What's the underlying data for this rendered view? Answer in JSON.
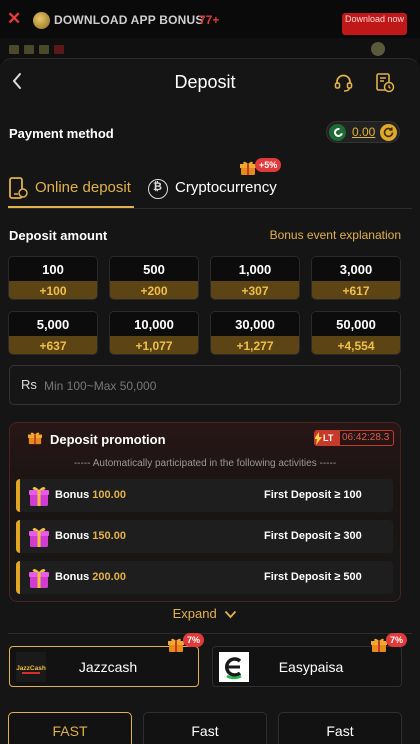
{
  "promo_bar": {
    "close_icon": "close-icon",
    "text": "DOWNLOAD APP  BONUS",
    "value": "77+",
    "download_label": "Download now"
  },
  "header": {
    "title": "Deposit",
    "back_icon": "chevron-left-icon",
    "support_icon": "headset-icon",
    "history_icon": "history-icon"
  },
  "payment_method": {
    "label": "Payment method",
    "balance": "0.00",
    "flag_icon": "pakistan-flag-icon",
    "refresh_icon": "refresh-icon"
  },
  "tabs": [
    {
      "label": "Online deposit",
      "icon": "phone-icon",
      "active": true
    },
    {
      "label": "Cryptocurrency",
      "icon": "crypto-coin-icon",
      "badge": "+5%",
      "active": false
    }
  ],
  "deposit_amount": {
    "label": "Deposit amount",
    "bonus_link": "Bonus event explanation",
    "options": [
      {
        "amount": "100",
        "bonus": "+100"
      },
      {
        "amount": "500",
        "bonus": "+200"
      },
      {
        "amount": "1,000",
        "bonus": "+307"
      },
      {
        "amount": "3,000",
        "bonus": "+617"
      },
      {
        "amount": "5,000",
        "bonus": "+637"
      },
      {
        "amount": "10,000",
        "bonus": "+1,077"
      },
      {
        "amount": "30,000",
        "bonus": "+1,277"
      },
      {
        "amount": "50,000",
        "bonus": "+4,554"
      }
    ],
    "currency": "Rs",
    "placeholder": "Min 100~Max 50,000"
  },
  "promotion": {
    "title": "Deposit promotion",
    "lt_tag": "LT",
    "countdown": "06:42:28.3",
    "subtitle": "----- Automatically participated in the following activities -----",
    "rows": [
      {
        "bonus_prefix": "Bonus",
        "bonus_value": "100.00",
        "condition": "First Deposit ≥ 100"
      },
      {
        "bonus_prefix": "Bonus",
        "bonus_value": "150.00",
        "condition": "First Deposit ≥ 300"
      },
      {
        "bonus_prefix": "Bonus",
        "bonus_value": "200.00",
        "condition": "First Deposit ≥ 500"
      }
    ],
    "expand_label": "Expand"
  },
  "methods": [
    {
      "label": "Jazzcash",
      "badge": "7%",
      "logo_text": "JazzCash",
      "selected": true
    },
    {
      "label": "Easypaisa",
      "badge": "7%",
      "selected": false
    }
  ],
  "speeds": [
    "FAST",
    "Fast",
    "Fast"
  ],
  "colors": {
    "accent": "#e2b14c",
    "badge_red": "#e03a3a",
    "bonus_bg": "#5c4415"
  }
}
